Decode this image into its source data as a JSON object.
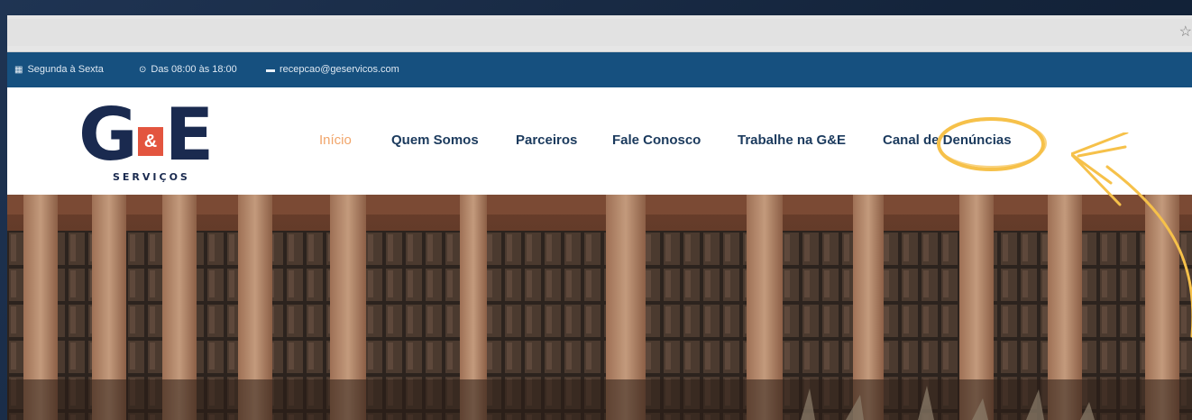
{
  "browser": {
    "bookmark_icon": "star-icon"
  },
  "topbar": {
    "days_icon": "calendar-icon",
    "days": "Segunda à Sexta",
    "hours_icon": "clock-icon",
    "hours": "Das 08:00 às 18:00",
    "email_icon": "envelope-icon",
    "email": "recepcao@geservicos.com"
  },
  "logo": {
    "mark_left": "G",
    "mark_amp": "&",
    "mark_right": "E",
    "subtitle": "SERVIÇOS"
  },
  "nav": {
    "items": [
      {
        "label": "Início",
        "active": true
      },
      {
        "label": "Quem Somos",
        "active": false
      },
      {
        "label": "Parceiros",
        "active": false
      },
      {
        "label": "Fale Conosco",
        "active": false
      },
      {
        "label": "Trabalhe na G&E",
        "active": false
      },
      {
        "label": "Canal de Denúncias",
        "active": false,
        "highlighted": true
      }
    ]
  },
  "colors": {
    "topbar": "#16507f",
    "nav_text": "#1b3a5d",
    "nav_active": "#f1a56a",
    "annotation": "#f6c14a",
    "logo_navy": "#1a2a4f",
    "logo_accent": "#e3553f"
  }
}
